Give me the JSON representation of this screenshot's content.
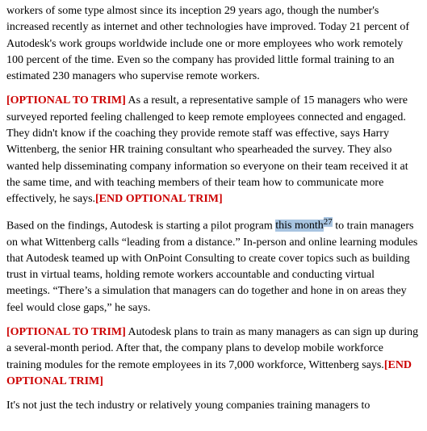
{
  "paragraphs": [
    {
      "id": "para1",
      "type": "normal",
      "parts": [
        {
          "type": "text",
          "content": "workers of some type almost since its inception 29 years ago, though the number’s increased recently as internet and other technologies have improved. Today 21 percent of Autodesk’s work groups worldwide include one or more employees who work remotely 100 percent of the time. Even so the company has provided little formal training to an estimated 230 managers who supervise remote workers."
        }
      ]
    },
    {
      "id": "para2",
      "type": "optional",
      "parts": [
        {
          "type": "optional-start",
          "content": "[OPTIONAL TO TRIM]"
        },
        {
          "type": "text",
          "content": " As a result, a representative sample of 15 managers who were surveyed reported feeling challenged to keep remote employees connected and engaged. They didn’t know if the coaching they provide remote staff was effective, says Harry Wittenberg, the senior HR training consultant who spearheaded the survey. They also wanted help disseminating company information so everyone on their team received it at the same time, and with teaching members of their team how to communicate more effectively, he says."
        },
        {
          "type": "optional-end",
          "content": "[END OPTIONAL TRIM]"
        }
      ]
    },
    {
      "id": "para3",
      "type": "normal",
      "parts": [
        {
          "type": "text",
          "content": "Based on the findings, Autodesk is starting a pilot program "
        },
        {
          "type": "highlight",
          "content": "this month"
        },
        {
          "type": "highlight-bracket",
          "content": "27"
        },
        {
          "type": "text",
          "content": " to train managers on what Wittenberg calls “leading from a distance.” In-person and online learning modules that Autodesk teamed up with OnPoint Consulting to create cover topics such as building trust in virtual teams, holding remote workers accountable and conducting virtual meetings. “There’s a simulation that managers can do together and hone in on areas they feel would close gaps,” he says."
        }
      ]
    },
    {
      "id": "para4",
      "type": "optional",
      "parts": [
        {
          "type": "optional-start",
          "content": "[OPTIONAL TO TRIM]"
        },
        {
          "type": "text",
          "content": " Autodesk plans to train as many managers as can sign up during a several-month period. After that, the company plans to develop mobile workforce training modules for the remote employees in its 7,000 workforce, Wittenberg says."
        },
        {
          "type": "optional-end",
          "content": "[END OPTIONAL TRIM]"
        }
      ]
    },
    {
      "id": "para5",
      "type": "normal",
      "parts": [
        {
          "type": "text",
          "content": "It’s not just the tech industry or relatively young companies training managers to"
        }
      ]
    }
  ]
}
